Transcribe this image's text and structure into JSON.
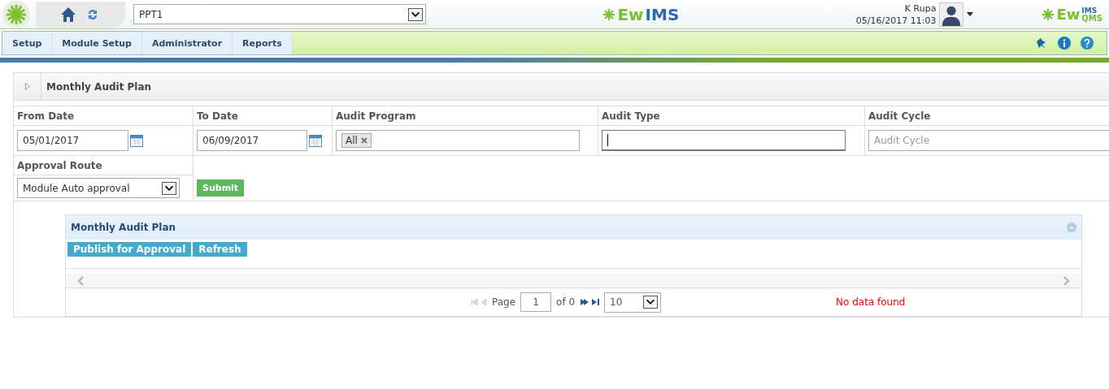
{
  "header": {
    "site_select": "PPT1",
    "logo_left": {
      "prefix": "Ew",
      "suffix": "IMS"
    },
    "user": {
      "name": "K Rupa",
      "datetime": "05/16/2017 11:03"
    },
    "logo_right": {
      "prefix": "Ew",
      "suffix": "QMS",
      "super": "IMS"
    }
  },
  "menu": [
    "Setup",
    "Module Setup",
    "Administrator",
    "Reports"
  ],
  "panel": {
    "title": "Monthly Audit Plan",
    "fields": [
      {
        "label": "From Date",
        "kind": "date",
        "value": "05/01/2017"
      },
      {
        "label": "To Date",
        "kind": "date",
        "value": "06/09/2017"
      },
      {
        "label": "Audit Program",
        "kind": "tags",
        "tags": [
          "All"
        ]
      },
      {
        "label": "Audit Type",
        "kind": "text",
        "focused": true
      },
      {
        "label": "Audit Cycle",
        "kind": "text",
        "placeholder": "Audit Cycle",
        "focused": false
      }
    ],
    "approval": {
      "label": "Approval Route",
      "value": "Module Auto approval"
    },
    "submit": "Submit"
  },
  "grid": {
    "title": "Monthly Audit Plan",
    "buttons": [
      "Publish for Approval",
      "Refresh"
    ],
    "pager": {
      "page_label": "Page",
      "page": "1",
      "of": "of 0",
      "page_size": "10",
      "message": "No data found"
    }
  }
}
